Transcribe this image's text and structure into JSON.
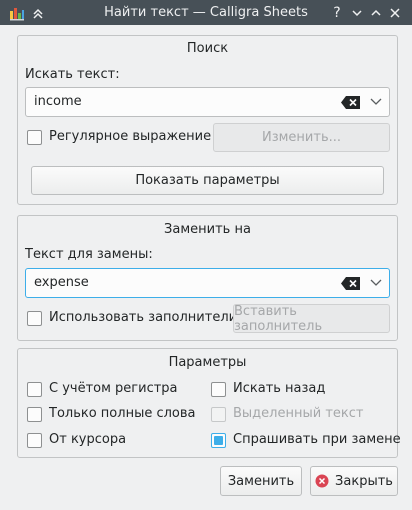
{
  "window": {
    "title": "Найти текст — Calligra Sheets",
    "help_glyph": "?"
  },
  "search_group": {
    "title": "Поиск",
    "find_label": "Искать текст:",
    "find_value": "income",
    "regex_label": "Регулярное выражение",
    "regex_checked": false,
    "edit_button": "Изменить...",
    "show_options_button": "Показать параметры"
  },
  "replace_group": {
    "title": "Заменить на",
    "replace_label": "Текст для замены:",
    "replace_value": "expense",
    "placeholders_label": "Использовать заполнители",
    "placeholders_checked": false,
    "insert_placeholder_button": "Вставить заполнитель"
  },
  "options_group": {
    "title": "Параметры",
    "case_sensitive": "С учётом регистра",
    "whole_words": "Только полные слова",
    "from_cursor": "От курсора",
    "find_backwards": "Искать назад",
    "selected_text": "Выделенный текст",
    "prompt_on_replace": "Спрашивать при замене",
    "prompt_on_replace_checked": true
  },
  "footer": {
    "replace_button": "Заменить",
    "close_button": "Закрыть"
  },
  "colors": {
    "accent": "#3daee9",
    "titlebar": "#475057",
    "close_red": "#da4453"
  }
}
